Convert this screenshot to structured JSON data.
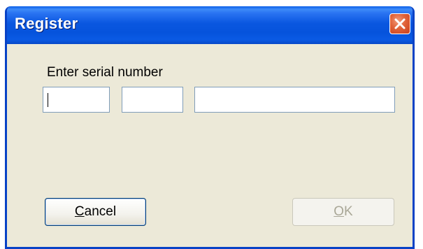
{
  "window": {
    "title": "Register"
  },
  "form": {
    "label": "Enter serial number",
    "fields": [
      {
        "value": ""
      },
      {
        "value": ""
      },
      {
        "value": ""
      }
    ]
  },
  "buttons": {
    "cancel": {
      "mnemonic": "C",
      "rest": "ancel",
      "enabled": true
    },
    "ok": {
      "mnemonic": "O",
      "rest": "K",
      "enabled": false
    }
  },
  "colors": {
    "titlebar": "#0a57e0",
    "client_bg": "#ece9d8",
    "close_button": "#e06238",
    "field_border": "#7f9db9",
    "disabled_text": "#a9a797"
  },
  "icons": {
    "close": "close-icon"
  }
}
